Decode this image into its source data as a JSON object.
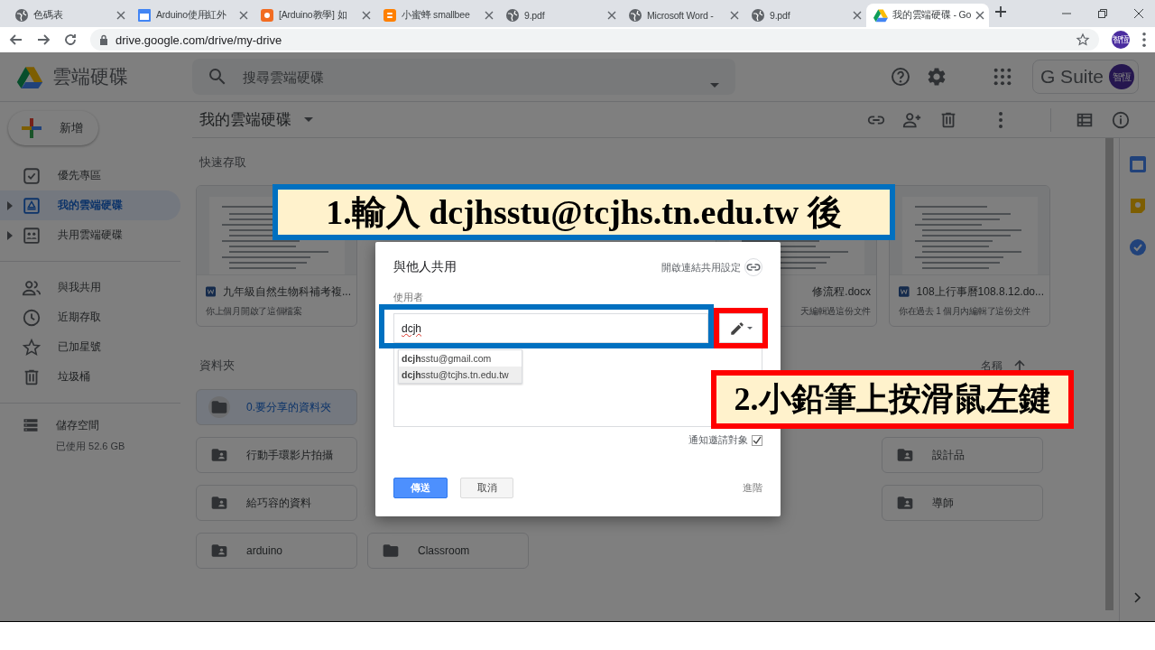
{
  "browser": {
    "tabs": [
      {
        "title": "色碼表",
        "selected": false
      },
      {
        "title": "Arduino使用紅外",
        "selected": false
      },
      {
        "title": "[Arduino教學] 如",
        "selected": false
      },
      {
        "title": "小蜜蜂 smallbee",
        "selected": false
      },
      {
        "title": "9.pdf",
        "selected": false
      },
      {
        "title": "Microsoft Word -",
        "selected": false
      },
      {
        "title": "9.pdf",
        "selected": false
      },
      {
        "title": "我的雲端硬碟 - Go",
        "selected": true
      }
    ],
    "url": "drive.google.com/drive/my-drive",
    "avatar": "智恆"
  },
  "header": {
    "product": "雲端硬碟",
    "search_placeholder": "搜尋雲端硬碟",
    "suite": "G Suite",
    "avatar": "智恆"
  },
  "sidebar": {
    "new_button": "新增",
    "items": [
      {
        "label": "優先專區",
        "selected": false,
        "expandable": false
      },
      {
        "label": "我的雲端硬碟",
        "selected": true,
        "expandable": true
      },
      {
        "label": "共用雲端硬碟",
        "selected": false,
        "expandable": true
      },
      {
        "label": "與我共用",
        "selected": false,
        "expandable": false
      },
      {
        "label": "近期存取",
        "selected": false,
        "expandable": false
      },
      {
        "label": "已加星號",
        "selected": false,
        "expandable": false
      },
      {
        "label": "垃圾桶",
        "selected": false,
        "expandable": false
      }
    ],
    "storage": {
      "label": "儲存空間",
      "usage": "已使用 52.6 GB"
    }
  },
  "main": {
    "title": "我的雲端硬碟",
    "quick_access_label": "快速存取",
    "quick_access": [
      {
        "kind": "doc",
        "name": "九年級自然生物科補考複...",
        "note": "你上個月開啟了這個檔案"
      },
      {
        "kind": "covered",
        "name": "修流程.docx",
        "note": "天編輯過這份文件"
      },
      {
        "kind": "doc",
        "name": "108上行事曆108.8.12.do...",
        "note": "你在過去 1 個月內編輯了這份文件"
      }
    ],
    "folders_label": "資料夾",
    "sort_label": "名稱",
    "folder_rows": [
      {
        "start": [
          {
            "name": "0.要分享的資料夾",
            "shared": false,
            "selected": true
          }
        ],
        "end": []
      },
      {
        "start": [
          {
            "name": "行動手環影片拍攝",
            "shared": true,
            "selected": false
          }
        ],
        "end": [
          {
            "name": "設計品",
            "shared": true,
            "selected": false
          }
        ]
      },
      {
        "start": [
          {
            "name": "給巧容的資料",
            "shared": true,
            "selected": false
          }
        ],
        "end": [
          {
            "name": "導師",
            "shared": true,
            "selected": false
          }
        ]
      },
      {
        "start": [
          {
            "name": "arduino",
            "shared": true,
            "selected": false
          },
          {
            "name": "Classroom",
            "shared": false,
            "selected": false
          }
        ],
        "end": []
      }
    ]
  },
  "dialog": {
    "title": "與他人共用",
    "link_settings": "開啟連結共用設定",
    "people_label": "使用者",
    "input_value": "dcjh",
    "suggestions": [
      {
        "text": "**dcjh**sstu@gmail.com",
        "selected": false
      },
      {
        "text": "**dcjh**sstu@tcjhs.tn.edu.tw",
        "selected": true
      }
    ],
    "notify_label": "通知邀請對象",
    "notify_checked": true,
    "send_button": "傳送",
    "cancel_button": "取消",
    "advanced_link": "進階"
  },
  "callouts": [
    {
      "text": "1.輸入 dcjhsstu@tcjhs.tn.edu.tw 後",
      "color": "#0070c0"
    },
    {
      "text": "2.小鉛筆上按滑鼠左鍵",
      "color": "#ff0000"
    }
  ],
  "highlights": [
    {
      "color": "#0070c0"
    },
    {
      "color": "#ff0000"
    }
  ]
}
